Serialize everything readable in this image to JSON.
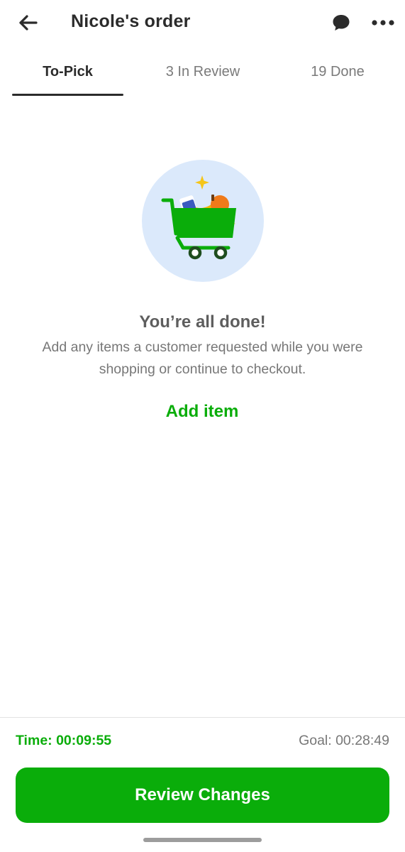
{
  "header": {
    "title": "Nicole's order",
    "back_icon": "arrow-left-icon",
    "chat_icon": "chat-bubble-icon",
    "more_icon": "more-horizontal-icon"
  },
  "tabs": [
    {
      "label": "To-Pick",
      "active": true
    },
    {
      "label": "3 In Review",
      "active": false
    },
    {
      "label": "19 Done",
      "active": false
    }
  ],
  "empty_state": {
    "illustration": "shopping-cart-illustration",
    "title": "You’re all done!",
    "subtitle": "Add any items a customer requested while you were shopping or continue to checkout.",
    "action_label": "Add item"
  },
  "footer": {
    "time_label": "Time: 00:09:55",
    "goal_label": "Goal: 00:28:49",
    "primary_button": "Review Changes"
  },
  "colors": {
    "accent": "#0aad0a",
    "illustration_bg": "#dbe9fb",
    "text_primary": "#2b2b2b",
    "text_secondary": "#777777"
  }
}
